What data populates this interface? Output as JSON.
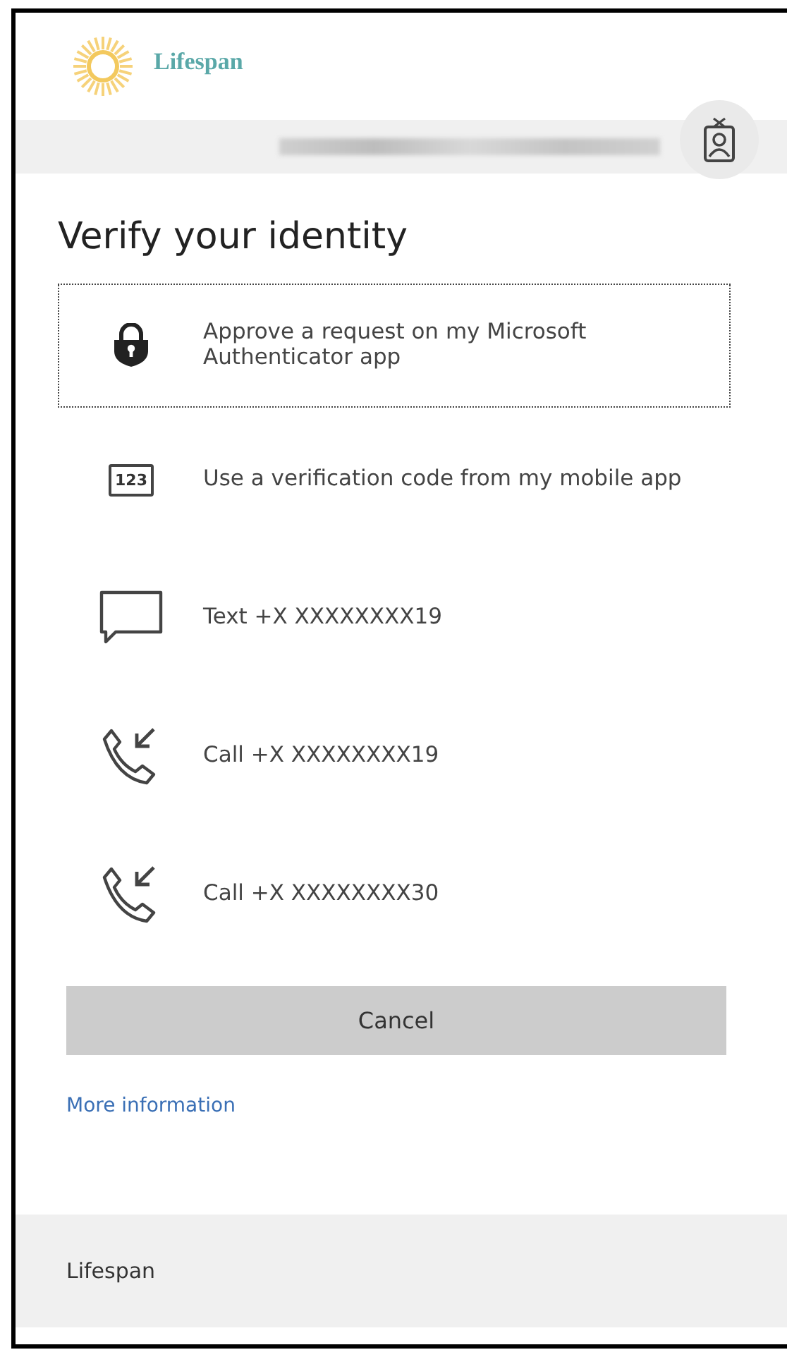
{
  "logo": {
    "name": "Lifespan"
  },
  "title": "Verify your identity",
  "options": [
    {
      "kind": "authenticator",
      "label": "Approve a request on my Microsoft Authenticator app",
      "selected": true
    },
    {
      "kind": "code",
      "icon_text": "123",
      "label": "Use a verification code from my mobile app",
      "selected": false
    },
    {
      "kind": "text",
      "label": "Text +X XXXXXXXX19",
      "selected": false
    },
    {
      "kind": "call",
      "label": "Call +X XXXXXXXX19",
      "selected": false
    },
    {
      "kind": "call",
      "label": "Call +X XXXXXXXX30",
      "selected": false
    }
  ],
  "cancel_button": "Cancel",
  "more_info_link": "More information",
  "footer": "Lifespan"
}
